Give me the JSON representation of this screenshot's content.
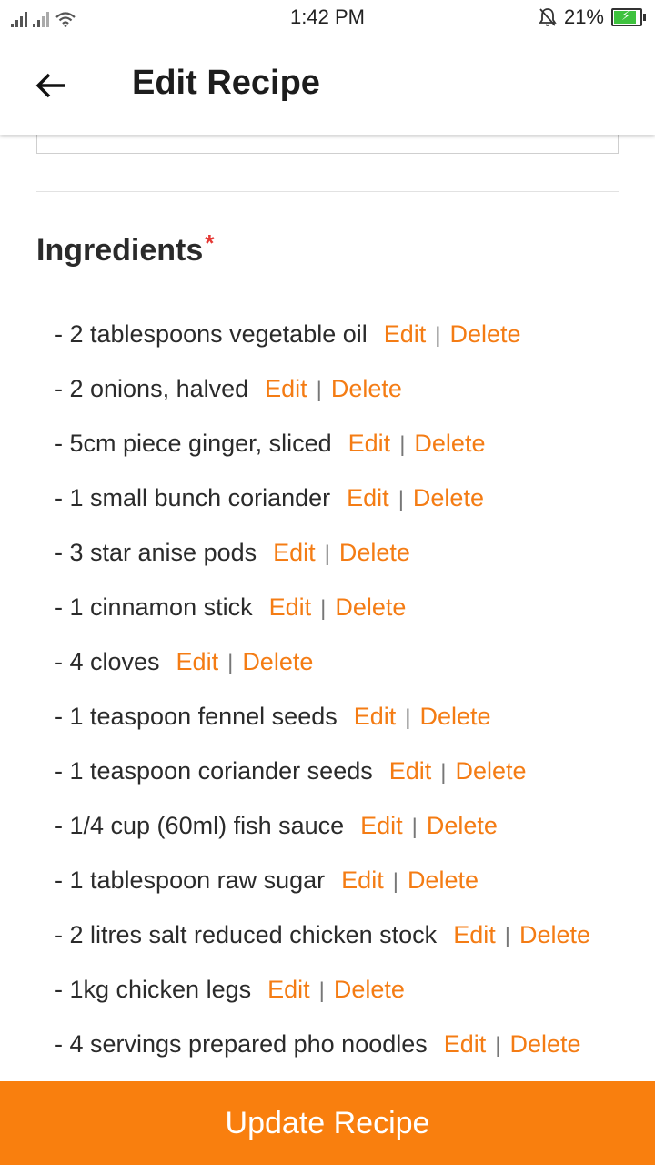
{
  "status_bar": {
    "time": "1:42 PM",
    "battery": "21%"
  },
  "header": {
    "title": "Edit Recipe",
    "back_icon": "arrow-left-icon"
  },
  "ingredients": {
    "title": "Ingredients",
    "required_mark": "*",
    "edit_label": "Edit",
    "delete_label": "Delete",
    "separator": "|",
    "items": [
      "- 2 tablespoons vegetable oil",
      "- 2 onions, halved",
      "- 5cm piece ginger, sliced",
      "- 1 small bunch coriander",
      "- 3 star anise pods",
      "- 1 cinnamon stick",
      "- 4 cloves",
      "- 1 teaspoon fennel seeds",
      "- 1 teaspoon coriander seeds",
      "- 1/4 cup (60ml) fish sauce",
      "- 1 tablespoon raw sugar",
      "- 2 litres salt reduced chicken stock",
      "- 1kg chicken legs",
      "- 4 servings prepared pho noodles"
    ]
  },
  "footer": {
    "update_label": "Update Recipe"
  },
  "colors": {
    "accent": "#f97f0e",
    "link": "#f47c14",
    "required": "#e53935"
  }
}
